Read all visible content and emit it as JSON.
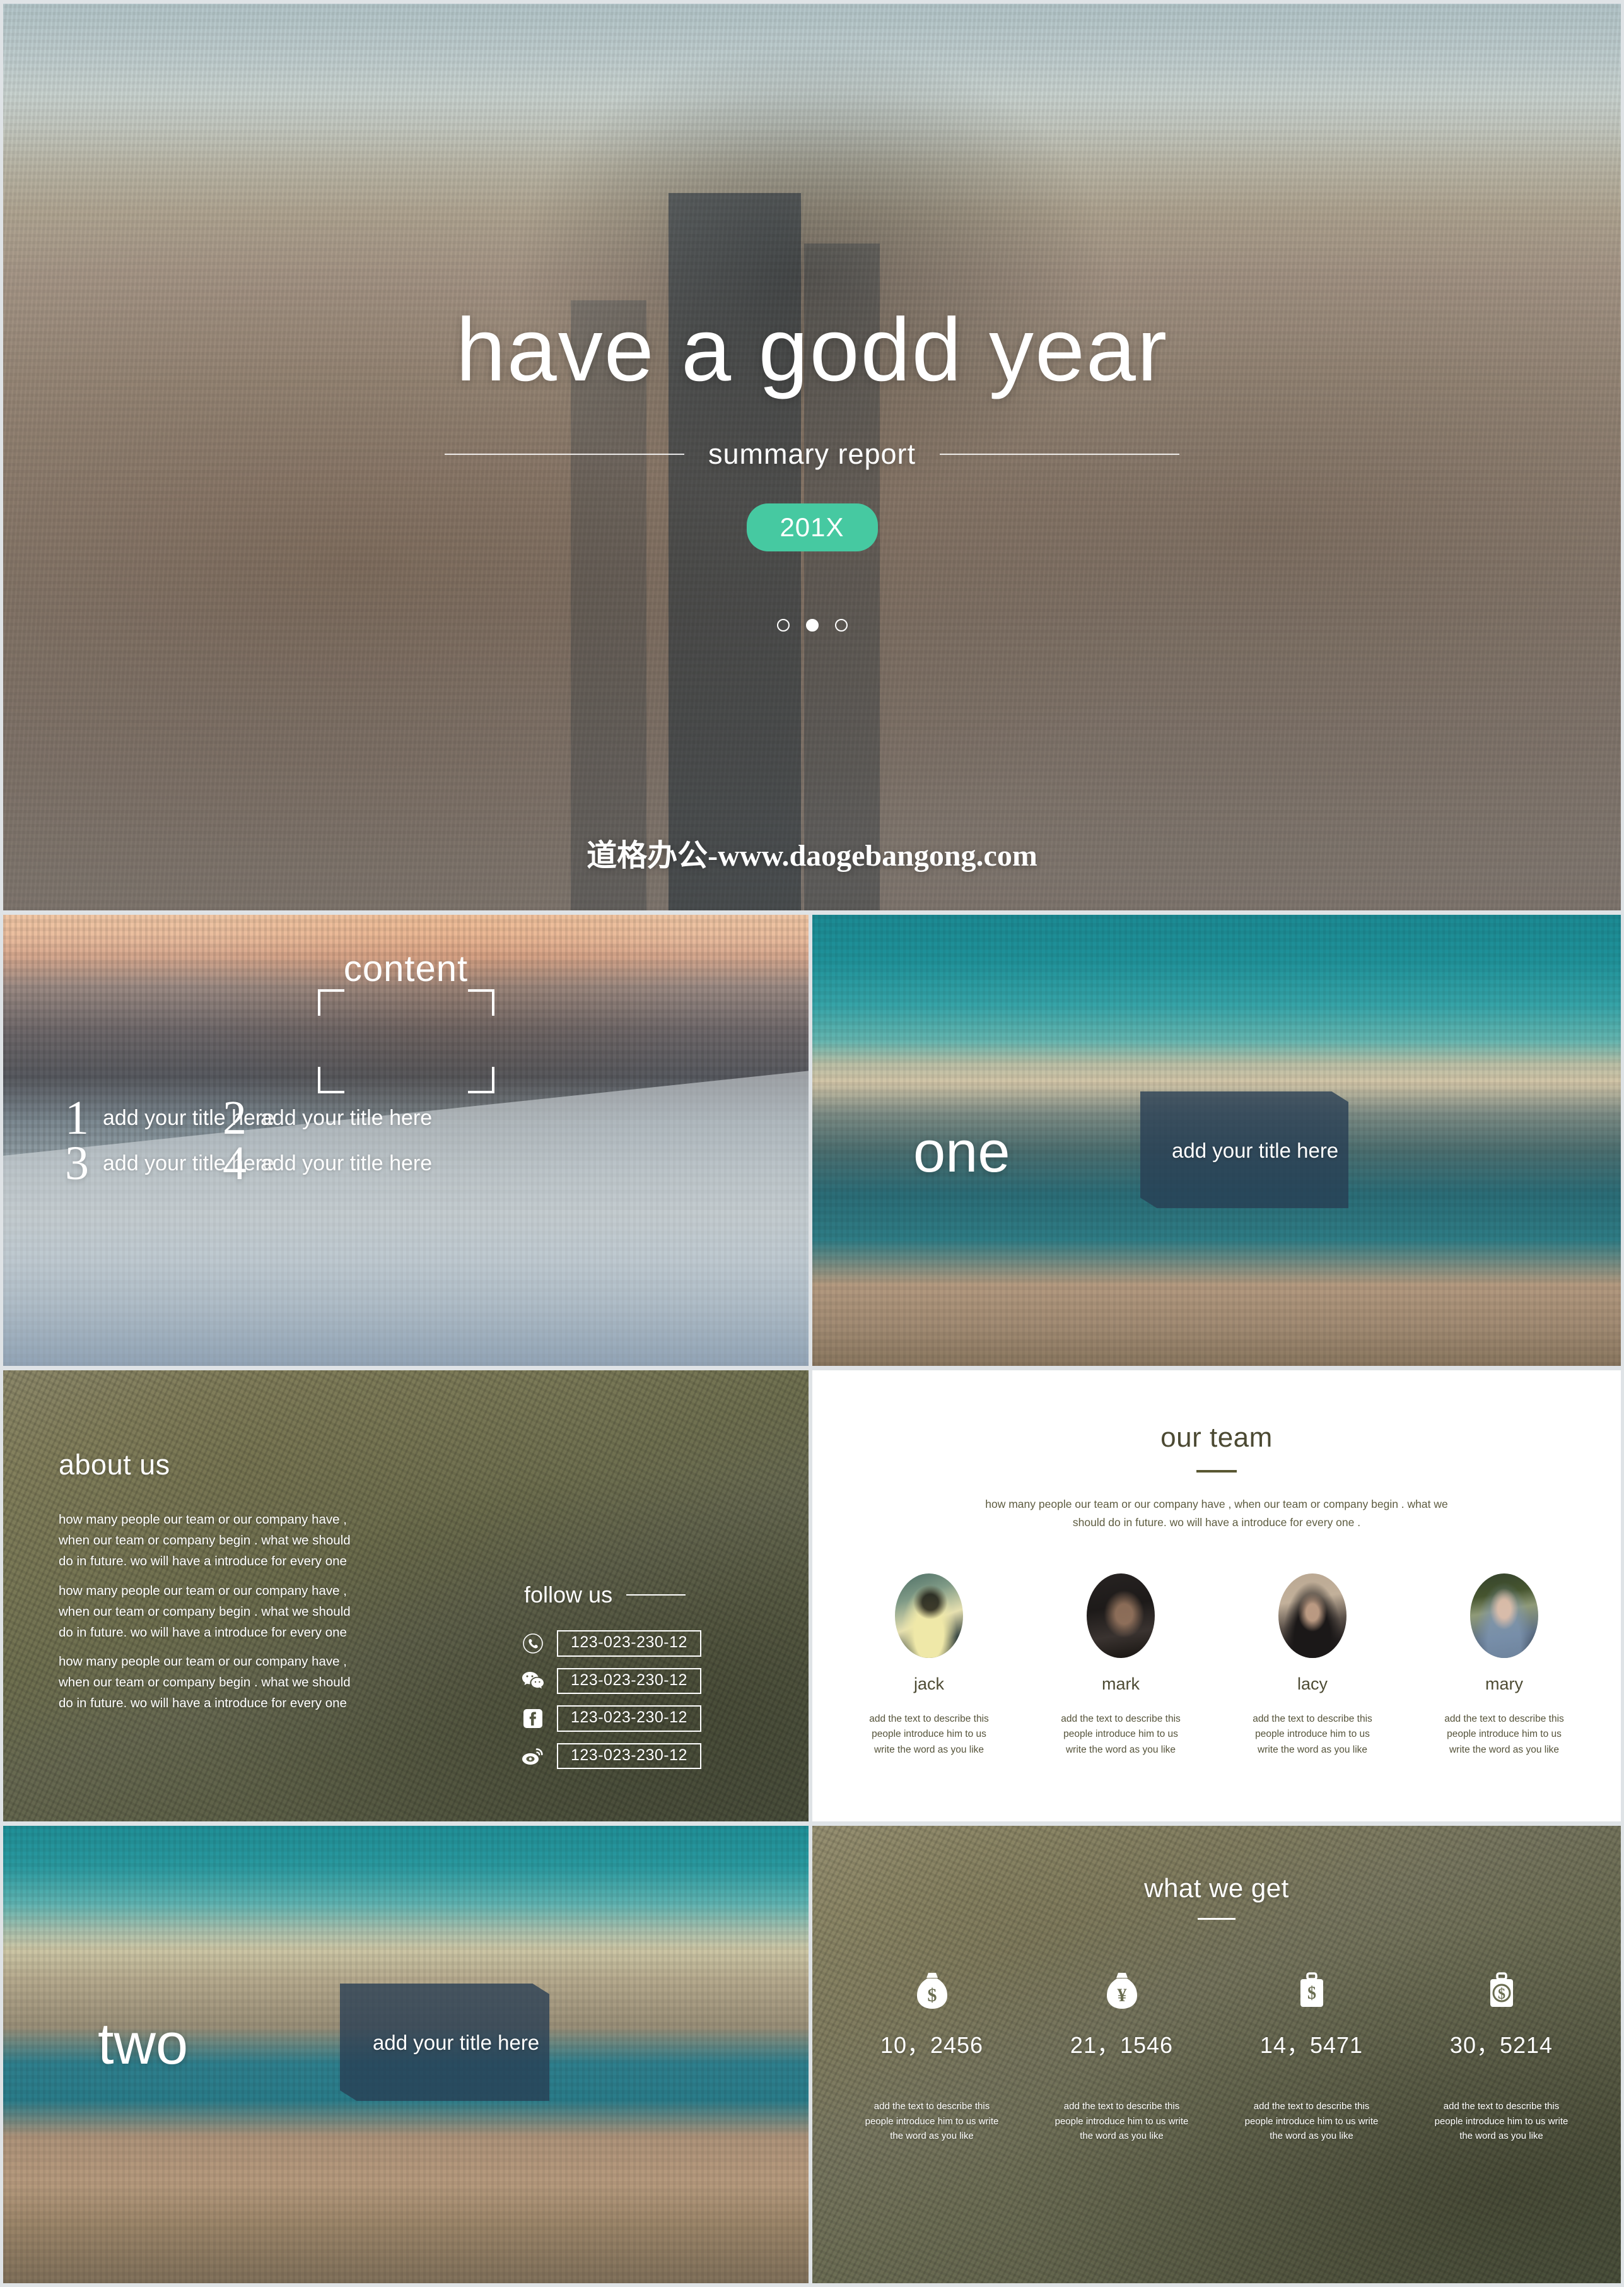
{
  "theme": {
    "accent_teal": "#46c9a1",
    "plate_navy": "#283e53",
    "team_text": "#4e4c34"
  },
  "slide_title": {
    "heading": "have a godd year",
    "subheading": "summary report",
    "year_badge": "201X",
    "watermark": "道格办公-www.daogebangong.com",
    "dots": [
      "inactive",
      "active",
      "inactive"
    ]
  },
  "slide_content": {
    "word": "content",
    "items": [
      {
        "num": "1",
        "label": "add your title here"
      },
      {
        "num": "2",
        "label": "add your title here"
      },
      {
        "num": "3",
        "label": "add your title here"
      },
      {
        "num": "4",
        "label": "add your title here"
      }
    ]
  },
  "slide_one": {
    "word": "one",
    "plate_label": "add your title here"
  },
  "slide_about": {
    "title": "about us",
    "paragraphs": [
      "how many people our team or our company have , when our team or company begin . what we should do in future. wo will have a introduce for every one",
      "how many people our team or our company have , when our team or company begin . what we should do in future. wo will have a introduce for every one",
      "how many people our team or our company have , when our team or company begin . what we should do in future. wo will have a introduce for every one"
    ],
    "follow_title": "follow us",
    "contacts": [
      {
        "icon": "phone-icon",
        "value": "123-023-230-12"
      },
      {
        "icon": "wechat-icon",
        "value": "123-023-230-12"
      },
      {
        "icon": "facebook-icon",
        "value": "123-023-230-12"
      },
      {
        "icon": "weibo-icon",
        "value": "123-023-230-12"
      }
    ]
  },
  "slide_team": {
    "title": "our team",
    "lead": "how many people our team or our company have , when our team or company begin . what we should do in future. wo will have a introduce for every one .",
    "members": [
      {
        "name": "jack",
        "desc": "add the text to describe this people introduce him to us write the word as you like"
      },
      {
        "name": "mark",
        "desc": "add the text to describe this people introduce him to us write the word as you like"
      },
      {
        "name": "lacy",
        "desc": "add the text to describe this people introduce him to us write the word as you like"
      },
      {
        "name": "mary",
        "desc": "add the text to describe this people introduce him to us write the word as you like"
      }
    ]
  },
  "slide_two": {
    "word": "two",
    "plate_label": "add your title here"
  },
  "slide_what": {
    "title": "what we get",
    "stats": [
      {
        "icon": "money-bag-dollar-icon",
        "value": "10，2456",
        "desc": "add the text to describe this people introduce him to us write the word as you like"
      },
      {
        "icon": "money-bag-yen-icon",
        "value": "21，1546",
        "desc": "add the text to describe this people introduce him to us write the word as you like"
      },
      {
        "icon": "briefcase-dollar-icon",
        "value": "14，5471",
        "desc": "add the text to describe this people introduce him to us write the word as you like"
      },
      {
        "icon": "briefcase-coin-icon",
        "value": "30，5214",
        "desc": "add the text to describe this people introduce him to us write the word as you like"
      }
    ]
  }
}
